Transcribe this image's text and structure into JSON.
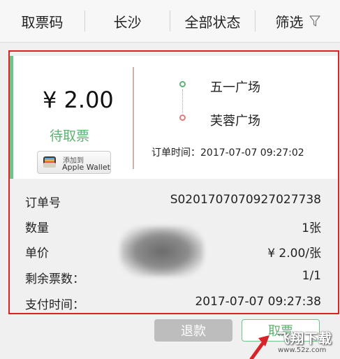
{
  "filter_bar": {
    "items": [
      {
        "label": "取票码"
      },
      {
        "label": "长沙"
      },
      {
        "label": "全部状态"
      },
      {
        "label": "筛选"
      }
    ]
  },
  "ticket": {
    "price": "¥ 2.00",
    "status": "待取票",
    "wallet_button": {
      "line1": "添加到",
      "line2": "Apple Wallet"
    },
    "from_station": "五一广场",
    "to_station": "芙蓉广场",
    "order_time": "订单时间：2017-07-07 09:27:02",
    "details": [
      {
        "label": "订单号",
        "value": "S0201707070927027738"
      },
      {
        "label": "数量",
        "value": "1张"
      },
      {
        "label": "单价",
        "value": "¥ 2.00/张"
      },
      {
        "label": "剩余票数：",
        "value": "1/1"
      },
      {
        "label": "支付时间：",
        "value": "2017-07-07 09:27:38"
      }
    ]
  },
  "actions": {
    "refund_label": "退款",
    "pickup_label": "取票"
  },
  "watermark": {
    "brand": "飞翔下载",
    "url": "www.52z.com"
  },
  "colors": {
    "accent_green": "#5bb36f",
    "highlight_red": "#d9232a",
    "destination_red": "#e27a7a",
    "disabled_gray": "#bdbdbd"
  },
  "icons": {
    "filter": "funnel-icon",
    "wallet": "wallet-icon",
    "annotation": "red-arrow-icon"
  }
}
